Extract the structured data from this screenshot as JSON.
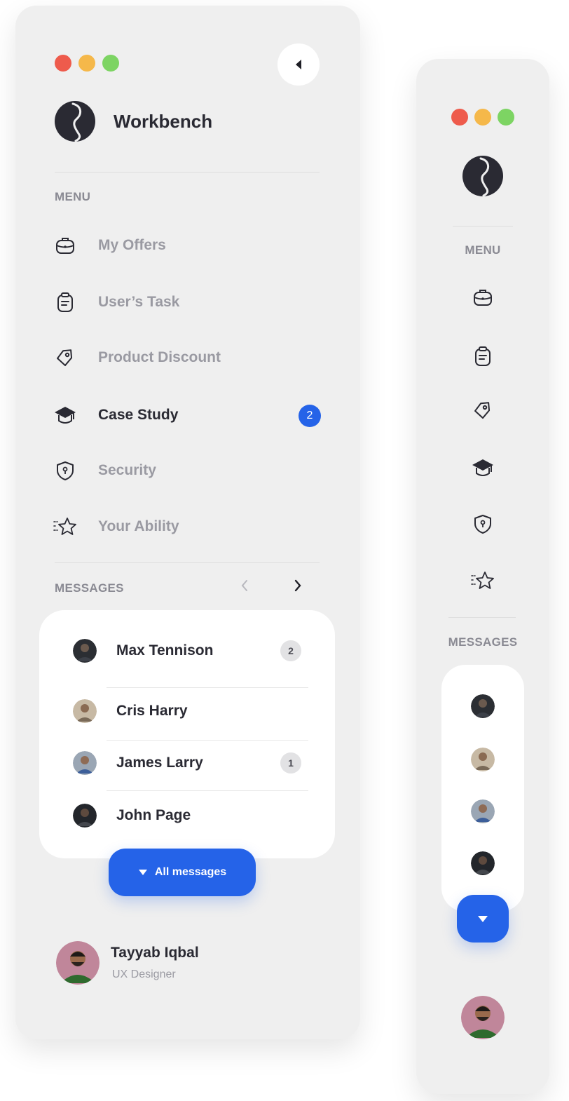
{
  "window_controls": {
    "close_color": "#ee5b4c",
    "minimize_color": "#f5b84a",
    "maximize_color": "#7dd463"
  },
  "brand": {
    "name": "Workbench"
  },
  "menu": {
    "label": "MENU",
    "items": [
      {
        "label": "My Offers",
        "icon": "briefcase-icon",
        "active": false
      },
      {
        "label": "User’s Task",
        "icon": "clipboard-icon",
        "active": false
      },
      {
        "label": "Product Discount",
        "icon": "price-tag-icon",
        "active": false
      },
      {
        "label": "Case Study",
        "icon": "graduation-cap-icon",
        "active": true,
        "badge": "2"
      },
      {
        "label": "Security",
        "icon": "shield-icon",
        "active": false
      },
      {
        "label": "Your Ability",
        "icon": "star-icon",
        "active": false
      }
    ]
  },
  "messages": {
    "label": "MESSAGES",
    "contacts": [
      {
        "name": "Max Tennison",
        "badge": "2"
      },
      {
        "name": "Cris Harry"
      },
      {
        "name": "James Larry",
        "badge": "1"
      },
      {
        "name": "John Page"
      }
    ],
    "all_button_label": "All messages"
  },
  "user": {
    "name": "Tayyab Iqbal",
    "role": "UX Designer"
  },
  "colors": {
    "accent": "#2563e8",
    "panel": "#efefef",
    "text": "#2a2a33",
    "muted": "#9a9aa2"
  }
}
